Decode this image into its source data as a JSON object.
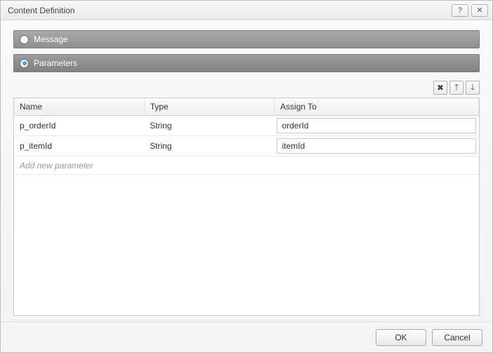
{
  "dialog": {
    "title": "Content Definition"
  },
  "options": {
    "message": {
      "label": "Message",
      "selected": false
    },
    "parameters": {
      "label": "Parameters",
      "selected": true
    }
  },
  "table": {
    "columns": {
      "name": "Name",
      "type": "Type",
      "assign": "Assign To"
    },
    "rows": [
      {
        "name": "p_orderId",
        "type": "String",
        "assign": "orderId"
      },
      {
        "name": "p_itemId",
        "type": "String",
        "assign": "itemId"
      }
    ],
    "add_placeholder": "Add new parameter"
  },
  "buttons": {
    "ok": "OK",
    "cancel": "Cancel"
  }
}
